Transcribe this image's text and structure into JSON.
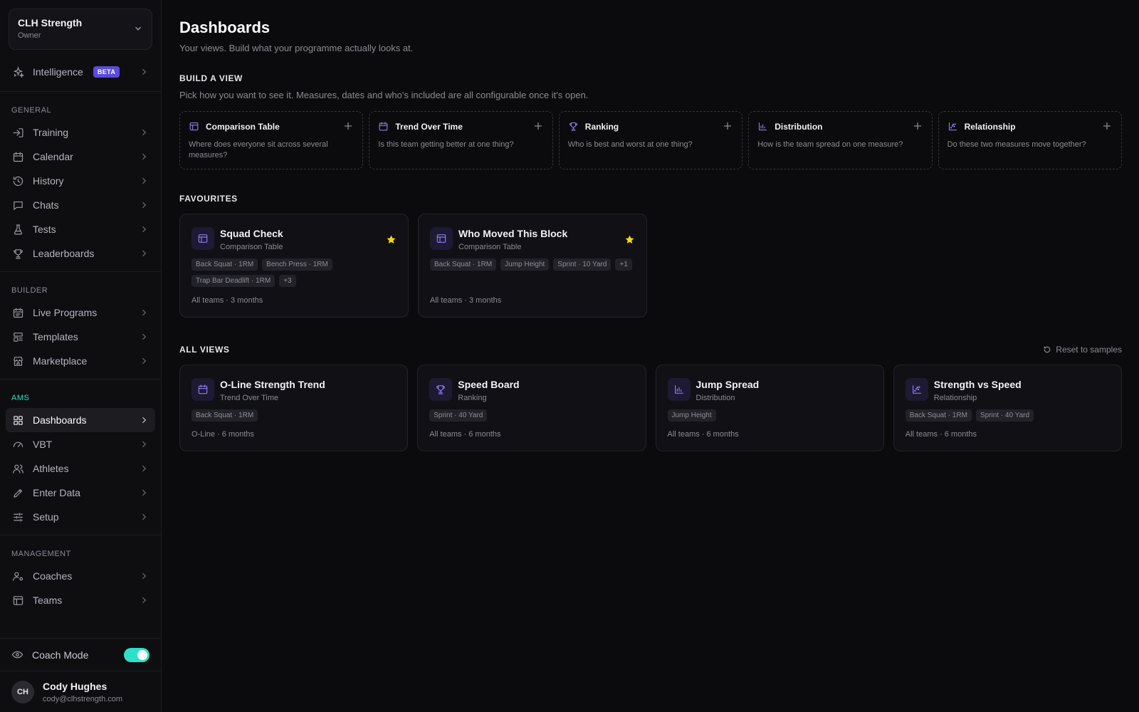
{
  "org": {
    "name": "CLH Strength",
    "role": "Owner"
  },
  "nav": {
    "intelligence": {
      "label": "Intelligence",
      "badge": "BETA"
    },
    "sections": {
      "general": "GENERAL",
      "builder": "BUILDER",
      "ams": "AMS",
      "management": "MANAGEMENT"
    },
    "general": [
      {
        "label": "Training",
        "icon": "login-arrow-icon"
      },
      {
        "label": "Calendar",
        "icon": "calendar-icon"
      },
      {
        "label": "History",
        "icon": "history-icon"
      },
      {
        "label": "Chats",
        "icon": "chat-icon"
      },
      {
        "label": "Tests",
        "icon": "flask-icon"
      },
      {
        "label": "Leaderboards",
        "icon": "trophy-icon"
      }
    ],
    "builder": [
      {
        "label": "Live Programs",
        "icon": "calendar-list-icon"
      },
      {
        "label": "Templates",
        "icon": "template-icon"
      },
      {
        "label": "Marketplace",
        "icon": "store-icon"
      }
    ],
    "ams": [
      {
        "label": "Dashboards",
        "icon": "grid-icon",
        "active": true
      },
      {
        "label": "VBT",
        "icon": "gauge-icon"
      },
      {
        "label": "Athletes",
        "icon": "users-icon"
      },
      {
        "label": "Enter Data",
        "icon": "pencil-icon"
      },
      {
        "label": "Setup",
        "icon": "sliders-icon"
      }
    ],
    "management": [
      {
        "label": "Coaches",
        "icon": "user-cog-icon"
      },
      {
        "label": "Teams",
        "icon": "table-icon"
      }
    ]
  },
  "coach_mode": {
    "label": "Coach Mode",
    "on": true
  },
  "user": {
    "initials": "CH",
    "name": "Cody Hughes",
    "email": "cody@clhstrength.com"
  },
  "page": {
    "title": "Dashboards",
    "subtitle": "Your views. Build what your programme actually looks at."
  },
  "build": {
    "heading": "BUILD A VIEW",
    "description": "Pick how you want to see it. Measures, dates and who's included are all configurable once it's open.",
    "cards": [
      {
        "title": "Comparison Table",
        "desc": "Where does everyone sit across several measures?",
        "icon": "table-icon"
      },
      {
        "title": "Trend Over Time",
        "desc": "Is this team getting better at one thing?",
        "icon": "calendar-icon"
      },
      {
        "title": "Ranking",
        "desc": "Who is best and worst at one thing?",
        "icon": "trophy-icon"
      },
      {
        "title": "Distribution",
        "desc": "How is the team spread on one measure?",
        "icon": "bar-chart-icon"
      },
      {
        "title": "Relationship",
        "desc": "Do these two measures move together?",
        "icon": "scatter-icon"
      }
    ]
  },
  "favourites": {
    "heading": "FAVOURITES",
    "cards": [
      {
        "title": "Squad Check",
        "type": "Comparison Table",
        "chips": [
          "Back Squat · 1RM",
          "Bench Press · 1RM",
          "Trap Bar Deadlift · 1RM",
          "+3"
        ],
        "scope": "All teams · 3 months"
      },
      {
        "title": "Who Moved This Block",
        "type": "Comparison Table",
        "chips": [
          "Back Squat · 1RM",
          "Jump Height",
          "Sprint · 10 Yard",
          "+1"
        ],
        "scope": "All teams · 3 months"
      }
    ]
  },
  "all_views": {
    "heading": "ALL VIEWS",
    "reset_label": "Reset to samples",
    "cards": [
      {
        "title": "O-Line Strength Trend",
        "type": "Trend Over Time",
        "chips": [
          "Back Squat · 1RM"
        ],
        "scope": "O-Line · 6 months",
        "icon": "calendar-icon"
      },
      {
        "title": "Speed Board",
        "type": "Ranking",
        "chips": [
          "Sprint · 40 Yard"
        ],
        "scope": "All teams · 6 months",
        "icon": "trophy-icon"
      },
      {
        "title": "Jump Spread",
        "type": "Distribution",
        "chips": [
          "Jump Height"
        ],
        "scope": "All teams · 6 months",
        "icon": "bar-chart-icon"
      },
      {
        "title": "Strength vs Speed",
        "type": "Relationship",
        "chips": [
          "Back Squat · 1RM",
          "Sprint · 40 Yard"
        ],
        "scope": "All teams · 6 months",
        "icon": "scatter-icon"
      }
    ]
  },
  "colors": {
    "accent": "#2de0c8",
    "brand": "#5b4bdc",
    "icon_purple": "#8a7cf0",
    "star": "#f5d90a"
  }
}
